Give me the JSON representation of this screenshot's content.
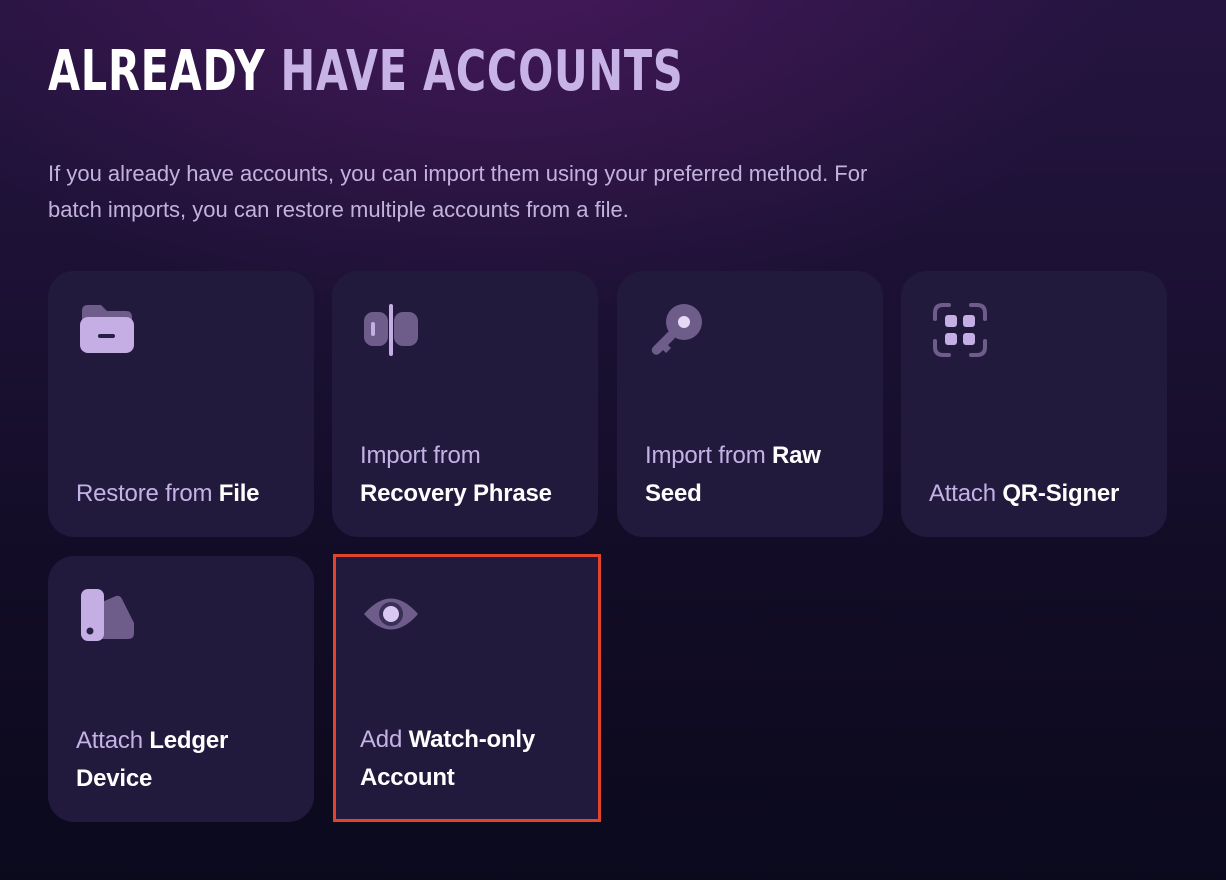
{
  "header": {
    "title_part1": "ALREADY",
    "title_part2": "HAVE ACCOUNTS",
    "description": "If you already have accounts, you can import them using your preferred method. For batch imports, you can restore multiple accounts from a file."
  },
  "colors": {
    "accent_light": "#c5b1e6",
    "card_bg": "#211a3c",
    "highlight_border": "#e2432b"
  },
  "options": [
    {
      "icon": "folder-icon",
      "label_dim": "Restore from",
      "label_bright": "File"
    },
    {
      "icon": "recovery-phrase-icon",
      "label_dim": "Import from",
      "label_bright": "Recovery Phrase"
    },
    {
      "icon": "key-icon",
      "label_dim": "Import from",
      "label_bright": "Raw Seed"
    },
    {
      "icon": "qr-scan-icon",
      "label_dim": "Attach",
      "label_bright": "QR-Signer"
    },
    {
      "icon": "ledger-device-icon",
      "label_dim": "Attach",
      "label_bright": "Ledger Device"
    },
    {
      "icon": "eye-icon",
      "label_dim": "Add",
      "label_bright": "Watch-only Account"
    }
  ]
}
